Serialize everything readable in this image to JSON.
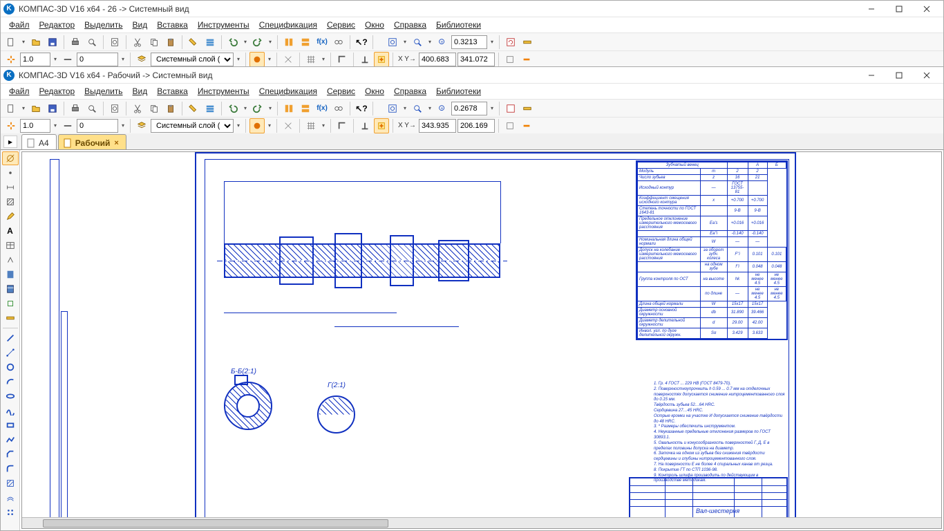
{
  "app": {
    "icon_letter": "K"
  },
  "win1": {
    "title": "КОМПАС-3D V16  x64 - 26 -> Системный вид",
    "menu": [
      "Файл",
      "Редактор",
      "Выделить",
      "Вид",
      "Вставка",
      "Инструменты",
      "Спецификация",
      "Сервис",
      "Окно",
      "Справка",
      "Библиотеки"
    ],
    "zoom_value": "0.3213",
    "line_weight": "1.0",
    "layer_offset": "0",
    "layer_name": "Системный слой (0)",
    "coord_x": "400.683",
    "coord_y": "341.072"
  },
  "win2": {
    "title": "КОМПАС-3D V16  x64 - Рабочий -> Системный вид",
    "menu": [
      "Файл",
      "Редактор",
      "Выделить",
      "Вид",
      "Вставка",
      "Инструменты",
      "Спецификация",
      "Сервис",
      "Окно",
      "Справка",
      "Библиотеки"
    ],
    "zoom_value": "0.2678",
    "line_weight": "1.0",
    "layer_offset": "0",
    "layer_name": "Системный слой (0)",
    "coord_x": "343.935",
    "coord_y": "206.169"
  },
  "tabs": {
    "inactive": "А4",
    "active": "Рабочий"
  },
  "drawing": {
    "table_header": "Зубчатый венец",
    "table_cols": [
      "",
      "А",
      "Б"
    ],
    "table_rows": [
      [
        "Модуль",
        "m",
        "2",
        "2"
      ],
      [
        "Число зубьев",
        "z",
        "16",
        "21"
      ],
      [
        "Исходный контур",
        "—",
        "ГОСТ 13755-81",
        ""
      ],
      [
        "Коэффициент смещения исходного контура",
        "x",
        "+0.700",
        "+0.700"
      ],
      [
        "Степень точности по ГОСТ 1643-81",
        "",
        "9-В",
        "9-В"
      ],
      [
        "Предельное отклонение измерительного межосевого расстояния",
        "Ea's",
        "+0.016",
        "+0.016"
      ],
      [
        "",
        "Ea''i",
        "-0.140",
        "-0.140"
      ],
      [
        "Номинальная длина общей нормали",
        "W",
        "—",
        "—"
      ],
      [
        "Допуск на колебание измерительного межосевого расстояния",
        "за оборот зубч. колеса",
        "F''i",
        "0.101",
        "0.101"
      ],
      [
        "",
        "на одном зубе",
        "f''i",
        "0.048",
        "0.048"
      ],
      [
        "Группа контроля по ОСТ",
        "на высоте",
        "hk",
        "не менее 4.5",
        "не менее 4.5"
      ],
      [
        "",
        "по длине",
        "—",
        "не менее 4.5",
        "не менее 4.5"
      ],
      [
        "Длина общей нормали",
        "W",
        "15x17",
        "15x17"
      ],
      [
        "Диаметр основной окружности",
        "db",
        "31.890",
        "39.466"
      ],
      [
        "Диаметр делительной окружности",
        "d",
        "29.00",
        "42.00"
      ],
      [
        "Инвол. угл. по дуге делительной окружн.",
        "Sα",
        "3.429",
        "3.633"
      ]
    ],
    "section_b_label": "Б-Б(2:1)",
    "section_g_label": "Г(2:1)",
    "notes": [
      "1. Гр. 4 ГОСТ ... 229 НВ (ГОСТ 8479-70).",
      "2. Поверхностноупрочнить h 0.59 ... 0.7 мм на отделочных поверхностях допускается снижение нитроцементованного слоя до 0.15 мм.",
      "Твёрдость зубьев 52…64 HRC.",
      "Сердцевина 27…45 HRC.",
      "Острые кромки на участке И допускается снижение твёрдости до 48 HRC.",
      "3. * Размеры обеспечить инструментом.",
      "4. Неуказанные предельные отклонения размеров по ГОСТ 30893.1.",
      "5. Овальность и конусообразность поверхностей Г, Д, Е в пределах половины допуска на диаметр.",
      "6. Заточка на одном из зубьев без снижения твёрдости сердцевины и глубины нитроцементованного слоя.",
      "7. На поверхности Е не более 4 спиральных канав от резца.",
      "8. Покрытие ГТ по СТП 1036-98.",
      "9. Контроль шлифа производить по действующим в производстве методикам."
    ],
    "titleblock_main": "Вал-шестерня"
  }
}
